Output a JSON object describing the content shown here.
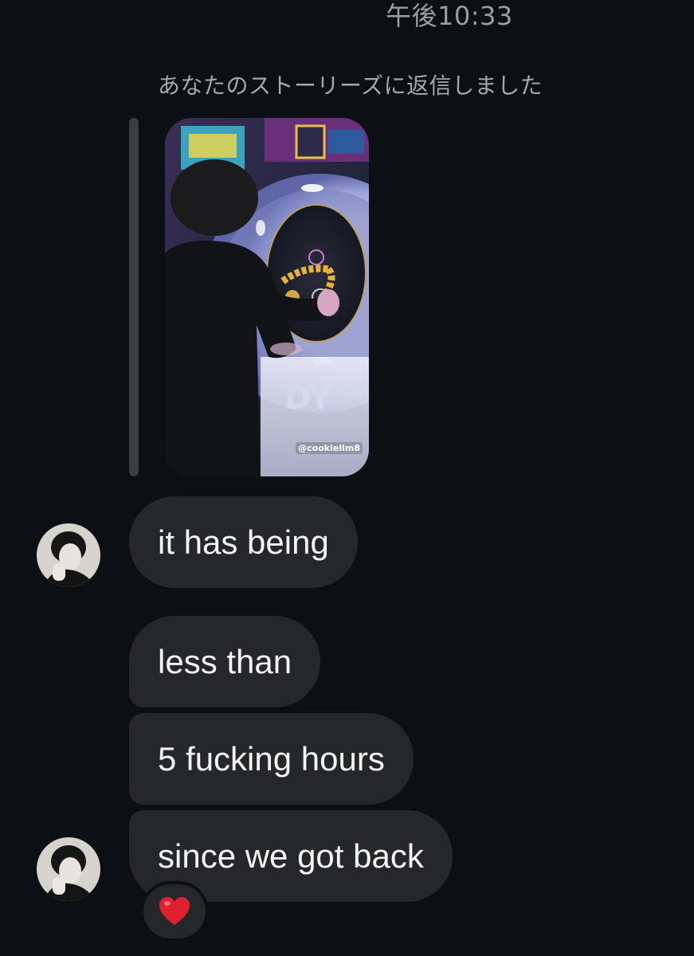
{
  "header": {
    "timestamp": "午後10:33"
  },
  "story_reply": {
    "note": "あなたのストーリーズに返信しました",
    "story_tag": "@cookielim8"
  },
  "messages": [
    {
      "text": "it has being",
      "show_avatar": true
    },
    {
      "text": "less than",
      "show_avatar": false
    },
    {
      "text": "5 fucking hours",
      "show_avatar": false
    },
    {
      "text": "since we got back",
      "show_avatar": true,
      "reaction": "heart-emoji"
    }
  ],
  "colors": {
    "background": "#0c1014",
    "bubble": "#25272b",
    "reaction_heart": "#e0202e"
  }
}
